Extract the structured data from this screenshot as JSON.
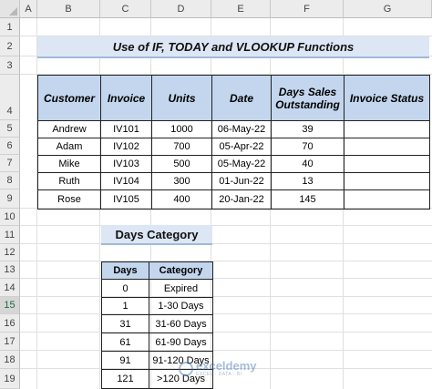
{
  "columns": [
    "A",
    "B",
    "C",
    "D",
    "E",
    "F",
    "G"
  ],
  "rows": [
    "1",
    "2",
    "3",
    "4",
    "5",
    "6",
    "7",
    "8",
    "9",
    "10",
    "11",
    "12",
    "13",
    "14",
    "15",
    "16",
    "17",
    "18",
    "19"
  ],
  "active_row": "15",
  "title": "Use of IF, TODAY and VLOOKUP Functions",
  "invoice_table": {
    "headers": [
      "Customer",
      "Invoice",
      "Units",
      "Date",
      "Days Sales Outstanding",
      "Invoice Status"
    ],
    "rows": [
      [
        "Andrew",
        "IV101",
        "1000",
        "06-May-22",
        "39",
        ""
      ],
      [
        "Adam",
        "IV102",
        "700",
        "05-Apr-22",
        "70",
        ""
      ],
      [
        "Mike",
        "IV103",
        "500",
        "05-May-22",
        "40",
        ""
      ],
      [
        "Ruth",
        "IV104",
        "300",
        "01-Jun-22",
        "13",
        ""
      ],
      [
        "Rose",
        "IV105",
        "400",
        "20-Jan-22",
        "145",
        ""
      ]
    ]
  },
  "days_category_label": "Days Category",
  "category_table": {
    "headers": [
      "Days",
      "Category"
    ],
    "rows": [
      [
        "0",
        "Expired"
      ],
      [
        "1",
        "1-30 Days"
      ],
      [
        "31",
        "31-60 Days"
      ],
      [
        "61",
        "61-90 Days"
      ],
      [
        "91",
        "91-120 Days"
      ],
      [
        "121",
        ">120 Days"
      ]
    ]
  },
  "watermark": {
    "name": "exceldemy",
    "tagline": "EXCEL · DATA · BI"
  },
  "colors": {
    "header_fill": "#c3d6ee",
    "title_fill": "#dce6f4",
    "active_row_text": "#1e6b3c"
  }
}
